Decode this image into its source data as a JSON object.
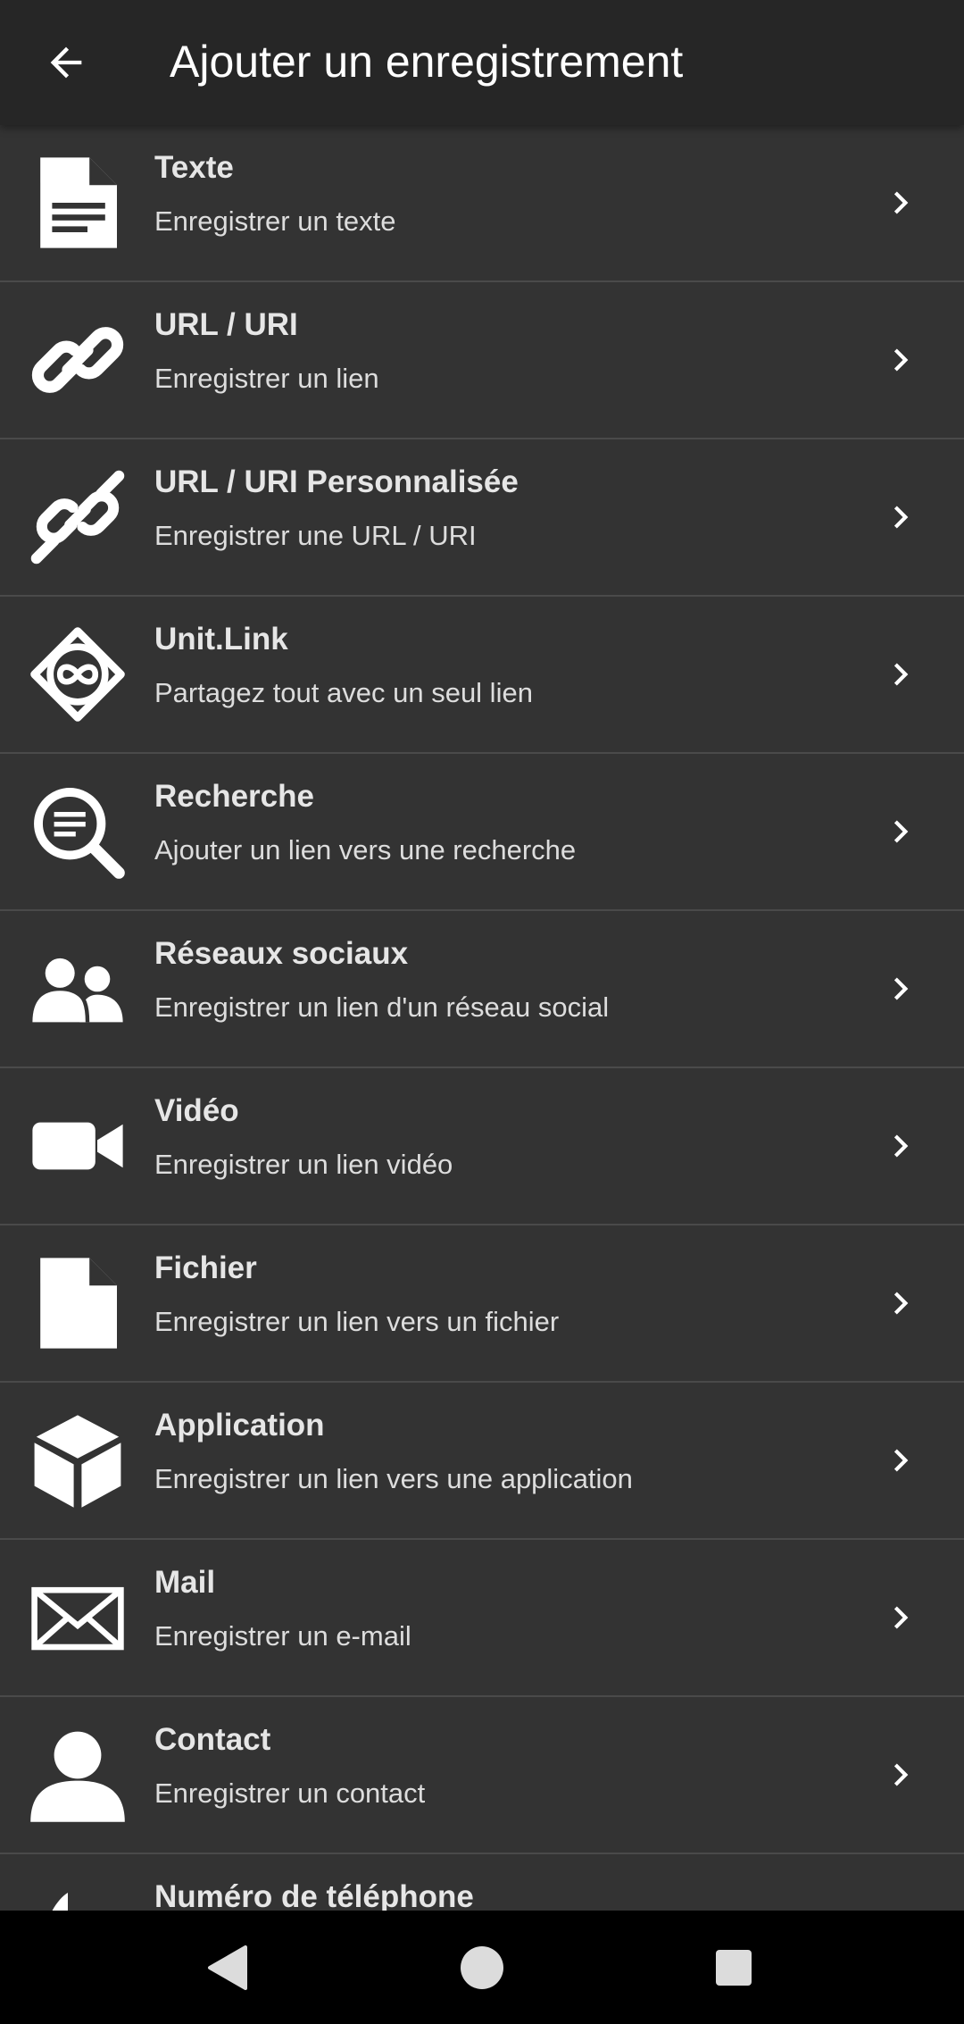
{
  "header": {
    "title": "Ajouter un enregistrement",
    "back_icon": "arrow-back-icon"
  },
  "items": [
    {
      "label": "Texte",
      "desc": "Enregistrer un texte",
      "icon": "document-icon"
    },
    {
      "label": "URL / URI",
      "desc": "Enregistrer un lien",
      "icon": "link-icon"
    },
    {
      "label": "URL / URI Personnalisée",
      "desc": "Enregistrer une URL / URI",
      "icon": "custom-link-icon"
    },
    {
      "label": "Unit.Link",
      "desc": "Partagez tout avec un seul lien",
      "icon": "unitlink-icon"
    },
    {
      "label": "Recherche",
      "desc": "Ajouter un lien vers une recherche",
      "icon": "search-icon"
    },
    {
      "label": "Réseaux sociaux",
      "desc": "Enregistrer un lien d'un réseau social",
      "icon": "people-icon"
    },
    {
      "label": "Vidéo",
      "desc": "Enregistrer un lien vidéo",
      "icon": "video-icon"
    },
    {
      "label": "Fichier",
      "desc": "Enregistrer un lien vers un fichier",
      "icon": "file-icon"
    },
    {
      "label": "Application",
      "desc": "Enregistrer un lien vers une application",
      "icon": "cube-icon"
    },
    {
      "label": "Mail",
      "desc": "Enregistrer un e-mail",
      "icon": "mail-icon"
    },
    {
      "label": "Contact",
      "desc": "Enregistrer un contact",
      "icon": "contact-icon"
    },
    {
      "label": "Numéro de téléphone",
      "desc": "",
      "icon": "phone-icon"
    }
  ],
  "colors": {
    "appbar": "#262626",
    "background": "#333333",
    "divider": "#4a4a4a",
    "navbar": "#000000"
  },
  "navigation": {
    "buttons": [
      "back-triangle-icon",
      "home-circle-icon",
      "recents-square-icon"
    ]
  }
}
